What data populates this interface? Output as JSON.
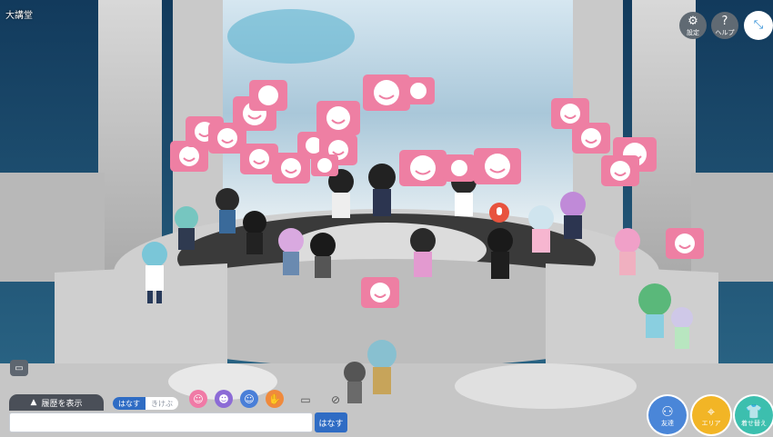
{
  "window": {
    "title": "大講堂"
  },
  "top_controls": {
    "settings_label": "設定",
    "help_symbol": "?",
    "help_label": "ヘルプ"
  },
  "chat": {
    "history_label": "履歴を表示",
    "history_arrow": "▲",
    "mode_talk": "はなす",
    "mode_listen": "きけぶ",
    "send_label": "はなす",
    "input_value": ""
  },
  "emotes": [
    {
      "name": "smile",
      "color": "#f07aa6"
    },
    {
      "name": "wink",
      "color": "#8c6bd6"
    },
    {
      "name": "sweat",
      "color": "#4a7fd8"
    },
    {
      "name": "wave",
      "color": "#f08a3c"
    }
  ],
  "bottom_right": {
    "friends_label": "友達",
    "area_label": "エリア",
    "dressup_label": "着せ替え",
    "friends_color": "#4a86d8",
    "area_color": "#f2b526",
    "dressup_color": "#3cbfae"
  },
  "scene": {
    "laugh_bubble_color": "#ee7fa3",
    "mic_color": "#e8533e",
    "bubble_count_visible": 26
  }
}
